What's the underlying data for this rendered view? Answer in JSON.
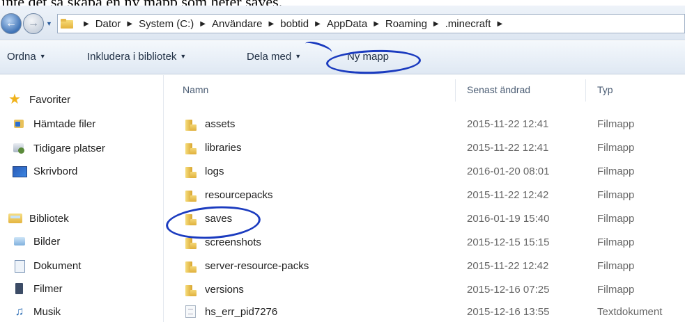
{
  "caption": "inte det så skapa en ny mapp som heter saves.",
  "address": {
    "crumbs": [
      "Dator",
      "System (C:)",
      "Användare",
      "bobtid",
      "AppData",
      "Roaming",
      ".minecraft"
    ]
  },
  "toolbar": {
    "organize": "Ordna",
    "include": "Inkludera i bibliotek",
    "share": "Dela med",
    "new_folder": "Ny mapp"
  },
  "nav": {
    "favorites": {
      "label": "Favoriter",
      "items": [
        "Hämtade filer",
        "Tidigare platser",
        "Skrivbord"
      ]
    },
    "libraries": {
      "label": "Bibliotek",
      "items": [
        "Bilder",
        "Dokument",
        "Filmer",
        "Musik"
      ]
    }
  },
  "list": {
    "columns": {
      "name": "Namn",
      "modified": "Senast ändrad",
      "type": "Typ"
    },
    "rows": [
      {
        "name": "assets",
        "modified": "2015-11-22 12:41",
        "type": "Filmapp",
        "icon": "folder-icon"
      },
      {
        "name": "libraries",
        "modified": "2015-11-22 12:41",
        "type": "Filmapp",
        "icon": "folder-icon"
      },
      {
        "name": "logs",
        "modified": "2016-01-20 08:01",
        "type": "Filmapp",
        "icon": "folder-icon"
      },
      {
        "name": "resourcepacks",
        "modified": "2015-11-22 12:42",
        "type": "Filmapp",
        "icon": "folder-icon"
      },
      {
        "name": "saves",
        "modified": "2016-01-19 15:40",
        "type": "Filmapp",
        "icon": "folder-icon"
      },
      {
        "name": "screenshots",
        "modified": "2015-12-15 15:15",
        "type": "Filmapp",
        "icon": "folder-icon"
      },
      {
        "name": "server-resource-packs",
        "modified": "2015-11-22 12:42",
        "type": "Filmapp",
        "icon": "folder-icon"
      },
      {
        "name": "versions",
        "modified": "2015-12-16 07:25",
        "type": "Filmapp",
        "icon": "folder-icon"
      },
      {
        "name": "hs_err_pid7276",
        "modified": "2015-12-16 13:55",
        "type": "Textdokument",
        "icon": "text-file-icon"
      }
    ]
  },
  "colors": {
    "annotation_ink": "#1b3bbf",
    "toolbar_top": "#f4f8fc",
    "toolbar_bottom": "#dfe8f3",
    "folder_yellow": "#e3b23c"
  }
}
